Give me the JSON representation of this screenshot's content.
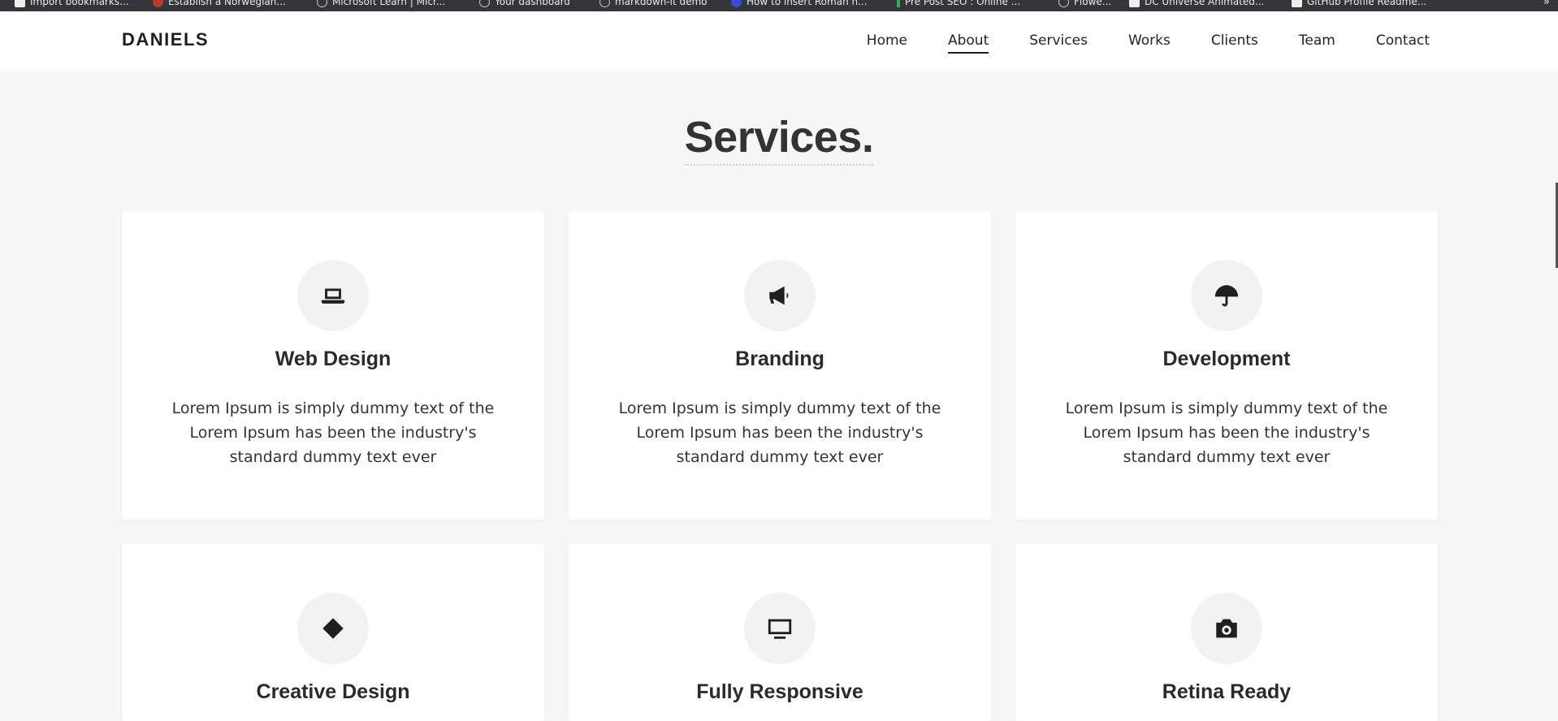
{
  "bookmarks": [
    {
      "label": "Import bookmarks..."
    },
    {
      "label": "Establish a Norwegian..."
    },
    {
      "label": "Microsoft Learn | Micr..."
    },
    {
      "label": "Your dashboard"
    },
    {
      "label": "markdown-it demo"
    },
    {
      "label": "How to insert Roman n..."
    },
    {
      "label": "Pre Post SEO : Online ..."
    },
    {
      "label": "Flowe..."
    },
    {
      "label": "DC Universe Animated..."
    },
    {
      "label": "GitHub Profile Readme..."
    }
  ],
  "header": {
    "logo": "DANIELS",
    "nav": [
      "Home",
      "About",
      "Services",
      "Works",
      "Clients",
      "Team",
      "Contact"
    ],
    "active": "About"
  },
  "section": {
    "title": "Services."
  },
  "cards": [
    {
      "title": "Web Design",
      "icon": "laptop-icon",
      "text": "Lorem Ipsum is simply dummy text of the Lorem Ipsum has been the industry's standard dummy text ever"
    },
    {
      "title": "Branding",
      "icon": "megaphone-icon",
      "text": "Lorem Ipsum is simply dummy text of the Lorem Ipsum has been the industry's standard dummy text ever"
    },
    {
      "title": "Development",
      "icon": "umbrella-icon",
      "text": "Lorem Ipsum is simply dummy text of the Lorem Ipsum has been the industry's standard dummy text ever"
    },
    {
      "title": "Creative Design",
      "icon": "diamond-icon",
      "text": ""
    },
    {
      "title": "Fully Responsive",
      "icon": "desktop-icon",
      "text": ""
    },
    {
      "title": "Retina Ready",
      "icon": "camera-icon",
      "text": ""
    }
  ]
}
